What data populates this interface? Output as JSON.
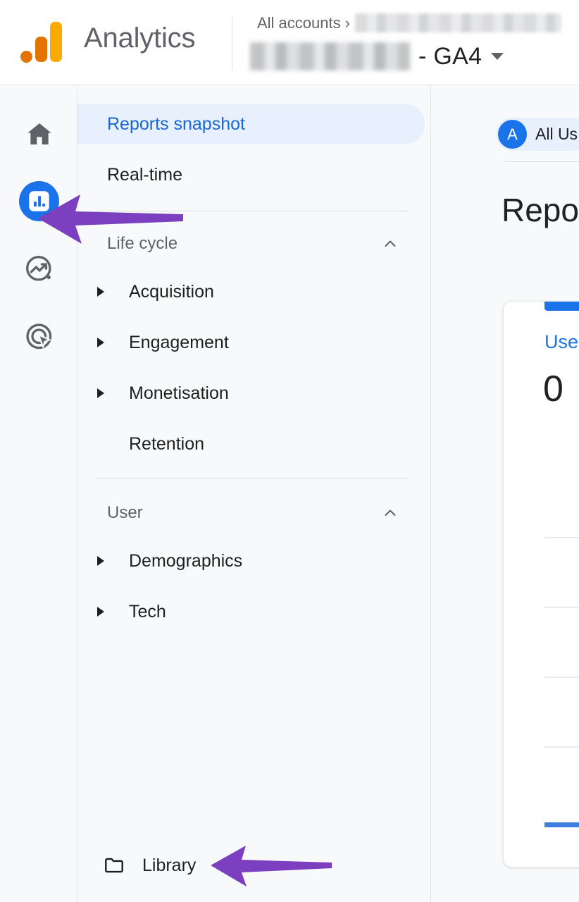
{
  "header": {
    "brand": "Analytics",
    "logo_icon": "analytics-logo-icon",
    "breadcrumb": {
      "all_accounts_label": "All accounts",
      "chevron": "›",
      "account_name": "",
      "property_name": "",
      "property_suffix": "- GA4",
      "caret_icon": "chevron-down-icon"
    },
    "colors": {
      "logo_orange_dark": "#e37400",
      "logo_orange_light": "#f9ab00",
      "brand_text": "#5f6368"
    }
  },
  "icon_rail": {
    "items": [
      {
        "name": "home",
        "icon": "home-icon",
        "active": false
      },
      {
        "name": "reports",
        "icon": "bar-chart-icon",
        "active": true
      },
      {
        "name": "explore",
        "icon": "explore-trend-icon",
        "active": false
      },
      {
        "name": "advertising",
        "icon": "advertising-target-icon",
        "active": false
      }
    ],
    "active_color": "#1a73e8",
    "inactive_color": "#5f6368"
  },
  "sidebar": {
    "top_items": [
      {
        "label": "Reports snapshot",
        "selected": true
      },
      {
        "label": "Real-time",
        "selected": false
      }
    ],
    "sections": [
      {
        "label": "Life cycle",
        "collapse_icon": "chevron-up-icon",
        "items": [
          {
            "label": "Acquisition",
            "expandable": true
          },
          {
            "label": "Engagement",
            "expandable": true
          },
          {
            "label": "Monetisation",
            "expandable": true
          },
          {
            "label": "Retention",
            "expandable": false
          }
        ]
      },
      {
        "label": "User",
        "collapse_icon": "chevron-up-icon",
        "items": [
          {
            "label": "Demographics",
            "expandable": true
          },
          {
            "label": "Tech",
            "expandable": true
          }
        ]
      }
    ],
    "library": {
      "label": "Library",
      "icon": "folder-icon"
    },
    "selected_bg": "#e8f0fe",
    "selected_text": "#1967d2"
  },
  "main": {
    "segment_chip": {
      "avatar_letter": "A",
      "label": "All Us"
    },
    "page_title": "Repor",
    "metric_card": {
      "metric_label": "Users",
      "metric_value": "0",
      "accent_color": "#1a73e8"
    }
  },
  "annotations": [
    {
      "name": "arrow-to-reports-icon",
      "color": "#7b3fbf",
      "direction": "left",
      "target": "reports-rail-icon"
    },
    {
      "name": "arrow-to-library",
      "color": "#7b3fbf",
      "direction": "left",
      "target": "library-nav-item"
    }
  ],
  "chart_data": {
    "type": "line",
    "title": "Users",
    "series": [
      {
        "name": "Users",
        "values": [
          0,
          0,
          0,
          0,
          0,
          0,
          0
        ]
      }
    ],
    "ylim": [
      0,
      4
    ],
    "gridlines": 4,
    "value_label": "0",
    "grid": true,
    "legend": "none"
  }
}
